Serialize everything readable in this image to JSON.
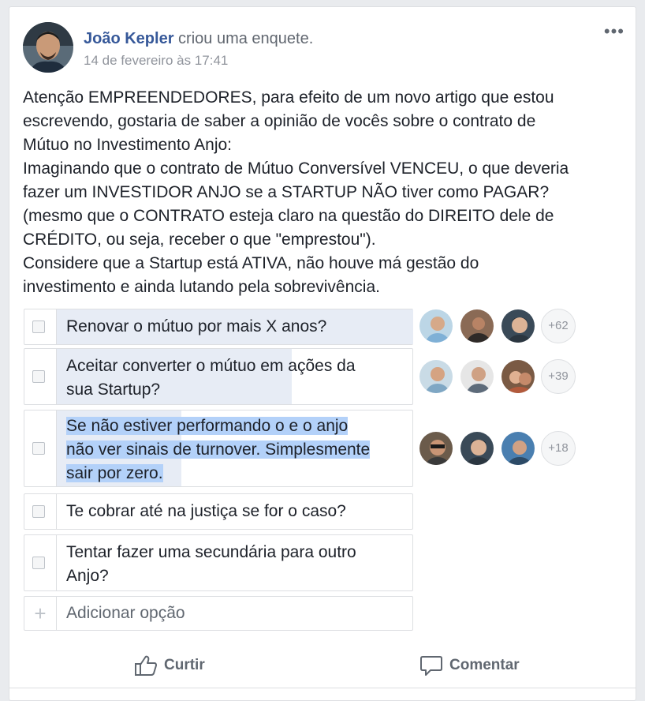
{
  "post": {
    "author": "João Kepler",
    "action": "criou uma enquete.",
    "timestamp": "14 de fevereiro às 17:41",
    "more_label": "•••",
    "text_lines": [
      "Atenção EMPREENDEDORES, para efeito de um novo artigo que estou",
      "escrevendo, gostaria de saber a opinião de vocês sobre o contrato de",
      "Mútuo no Investimento Anjo:",
      "Imaginando que o contrato de Mútuo Conversível VENCEU, o que deveria",
      "fazer um INVESTIDOR ANJO se a STARTUP NÃO tiver como PAGAR?",
      "(mesmo que o CONTRATO esteja claro na questão do DIREITO dele de",
      "CRÉDITO, ou seja, receber o que \"emprestou\").",
      "Considere que a Startup está ATIVA, não houve má gestão do",
      "investimento e ainda lutando pela sobrevivência."
    ]
  },
  "poll": {
    "options": [
      {
        "lines": [
          "Renovar o mútuo por mais X anos?"
        ],
        "extra_voters": "+62",
        "bar_fraction": 1.0
      },
      {
        "lines": [
          "Aceitar converter o mútuo em ações da",
          "sua Startup?"
        ],
        "extra_voters": "+39",
        "bar_fraction": 0.66
      },
      {
        "lines": [
          "Se não estiver performando o e o anjo",
          "não ver sinais de turnover. Simplesmente",
          "sair por zero."
        ],
        "extra_voters": "+18",
        "bar_fraction": 0.35
      },
      {
        "lines": [
          "Te cobrar até na justiça se for o caso?"
        ],
        "extra_voters": null,
        "bar_fraction": 0
      },
      {
        "lines": [
          "Tentar fazer uma secundária para outro",
          "Anjo?"
        ],
        "extra_voters": null,
        "bar_fraction": 0
      }
    ],
    "add_option_label": "Adicionar opção",
    "add_option_icon": "+"
  },
  "actions": {
    "like": "Curtir",
    "comment": "Comentar"
  },
  "colors": {
    "link": "#365899",
    "poll_bar": "#e7ecf5",
    "selection": "#b3d1f9"
  }
}
